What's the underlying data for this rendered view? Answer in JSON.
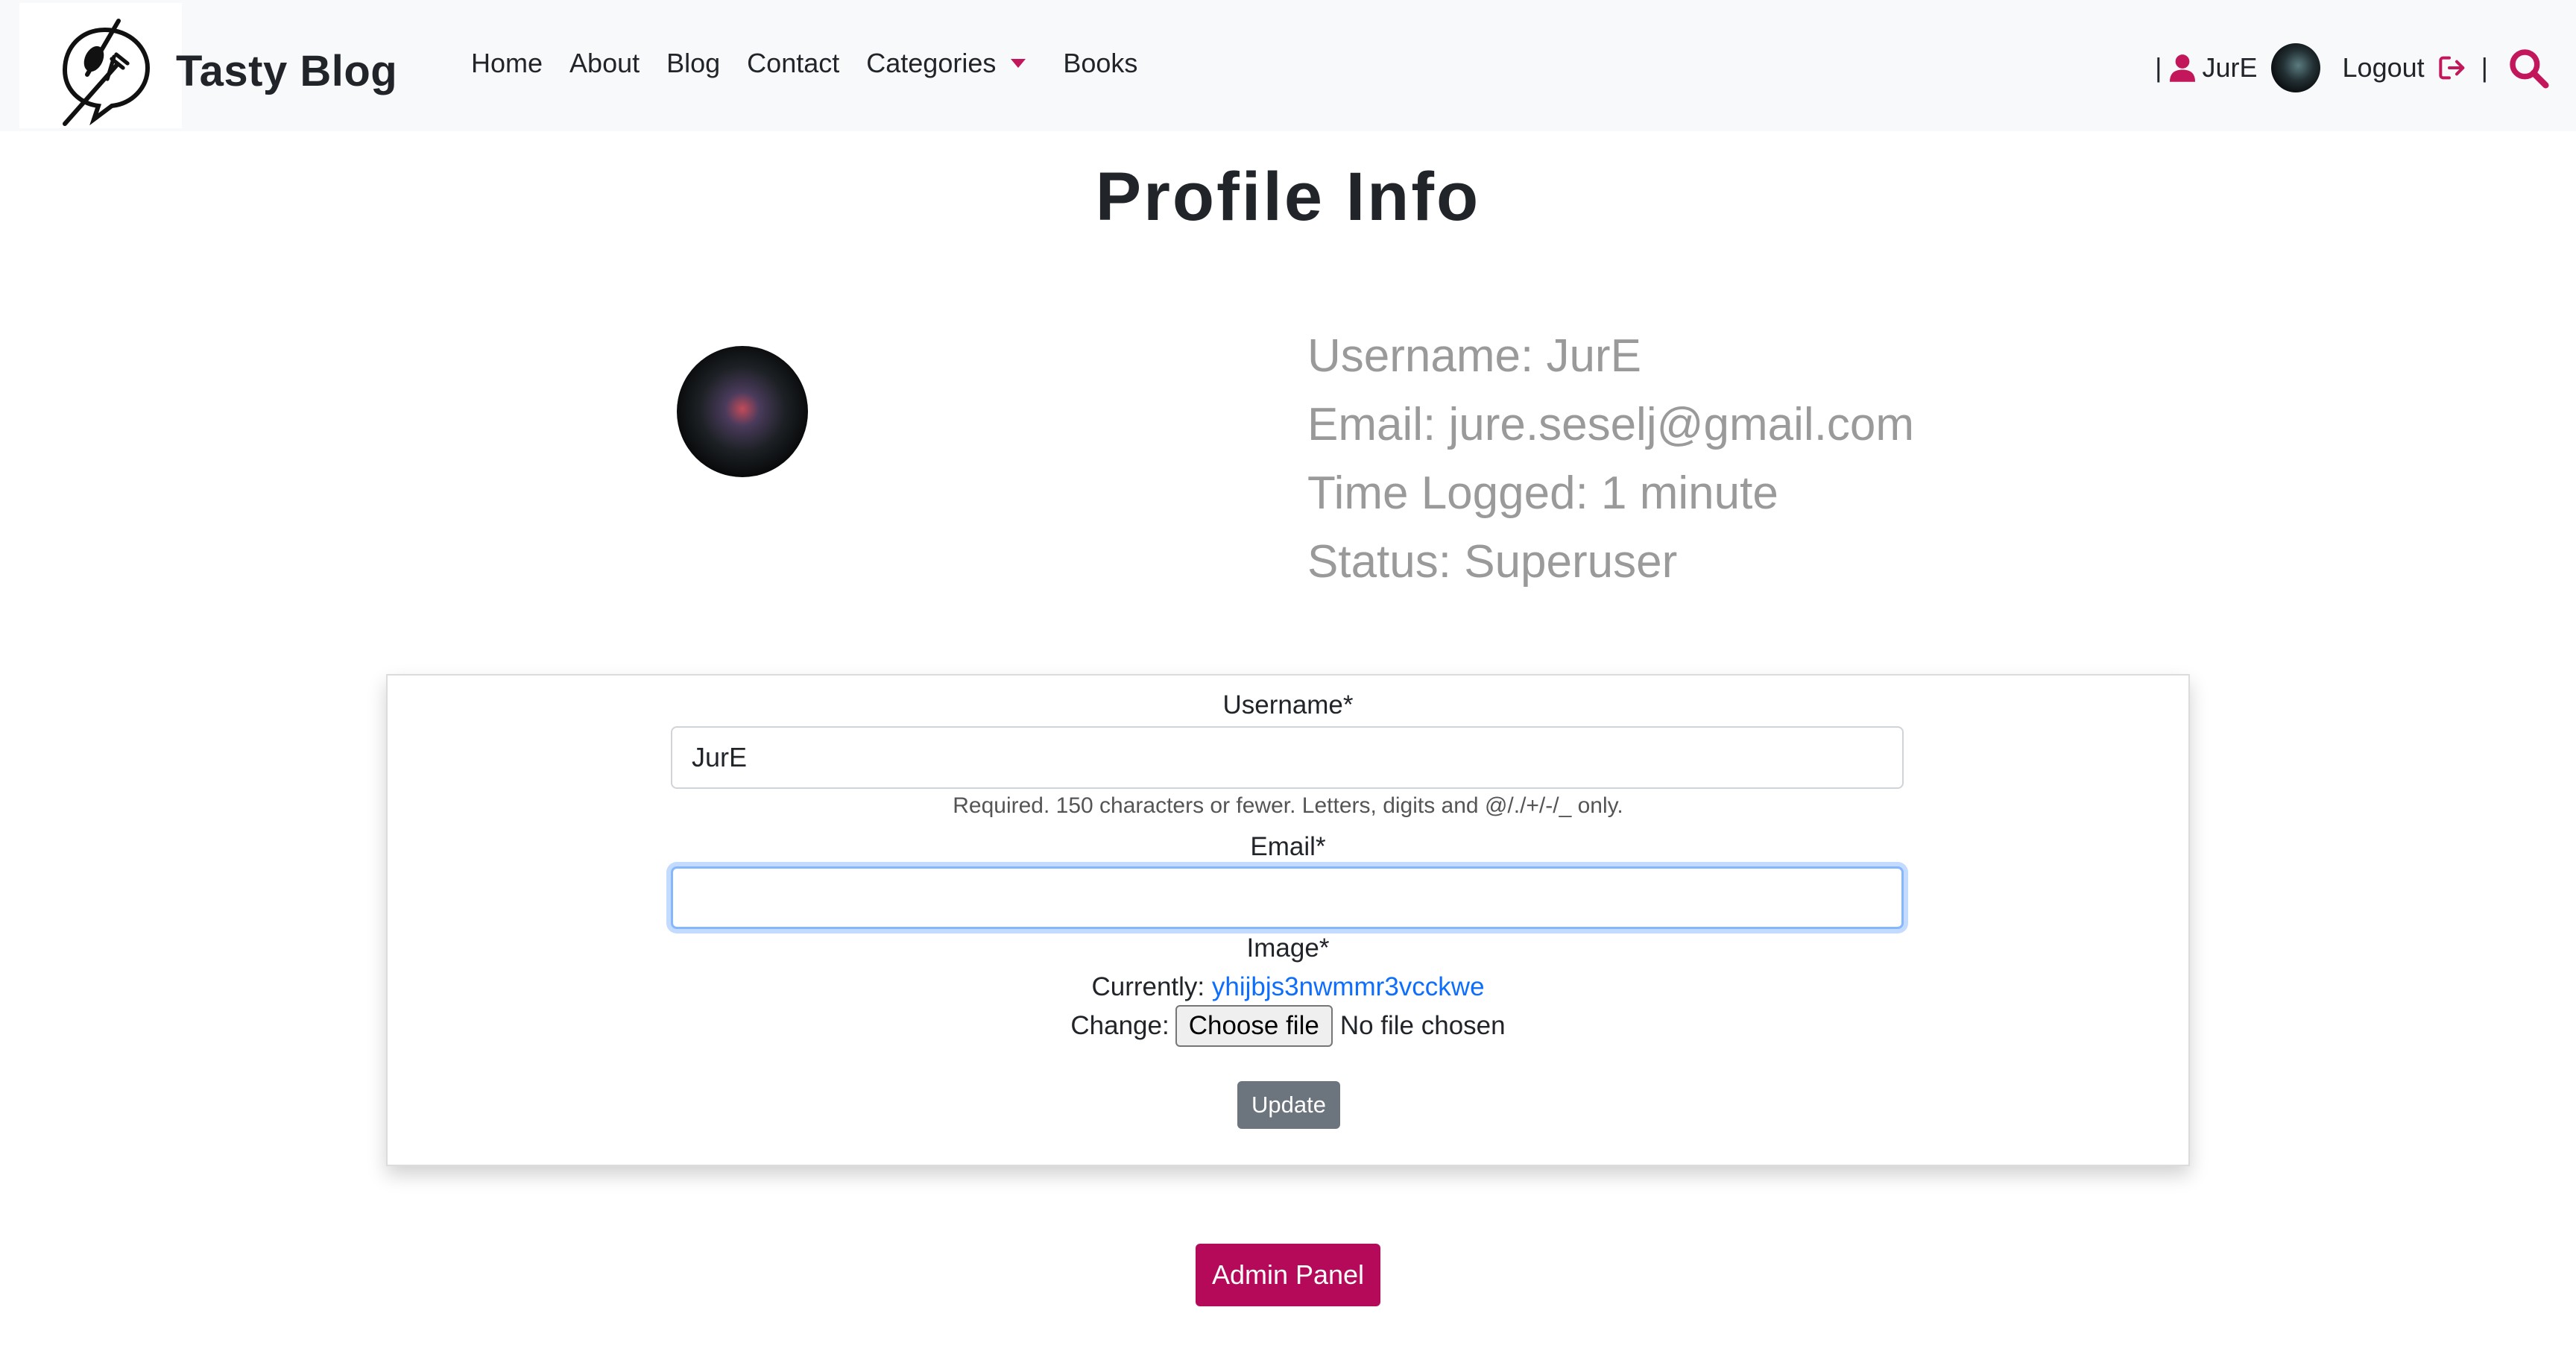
{
  "brand": {
    "name": "Tasty Blog",
    "logo_icon": "fork-spoon-chat-icon"
  },
  "nav": {
    "links": [
      "Home",
      "About",
      "Blog",
      "Contact"
    ],
    "categories_label": "Categories",
    "books_label": "Books",
    "separator": "|",
    "username": "JurE",
    "logout_label": "Logout",
    "accent_color": "#c2185b"
  },
  "profile": {
    "title": "Profile Info",
    "username_line": "Username: JurE",
    "email_line": "Email: jure.seselj@gmail.com",
    "time_line": "Time Logged: 1 minute",
    "status_line": "Status: Superuser"
  },
  "form": {
    "username_label": "Username*",
    "username_value": "JurE",
    "username_help": "Required. 150 characters or fewer. Letters, digits and @/./+/-/_ only.",
    "email_label": "Email*",
    "email_value": "",
    "image_label": "Image*",
    "currently_label": "Currently:",
    "current_file": "yhijbjs3nwmmr3vcckwe",
    "change_label": "Change:",
    "choose_file_label": "Choose file",
    "no_file_label": "No file chosen",
    "update_label": "Update"
  },
  "admin": {
    "label": "Admin Panel",
    "color": "#b5095a"
  }
}
